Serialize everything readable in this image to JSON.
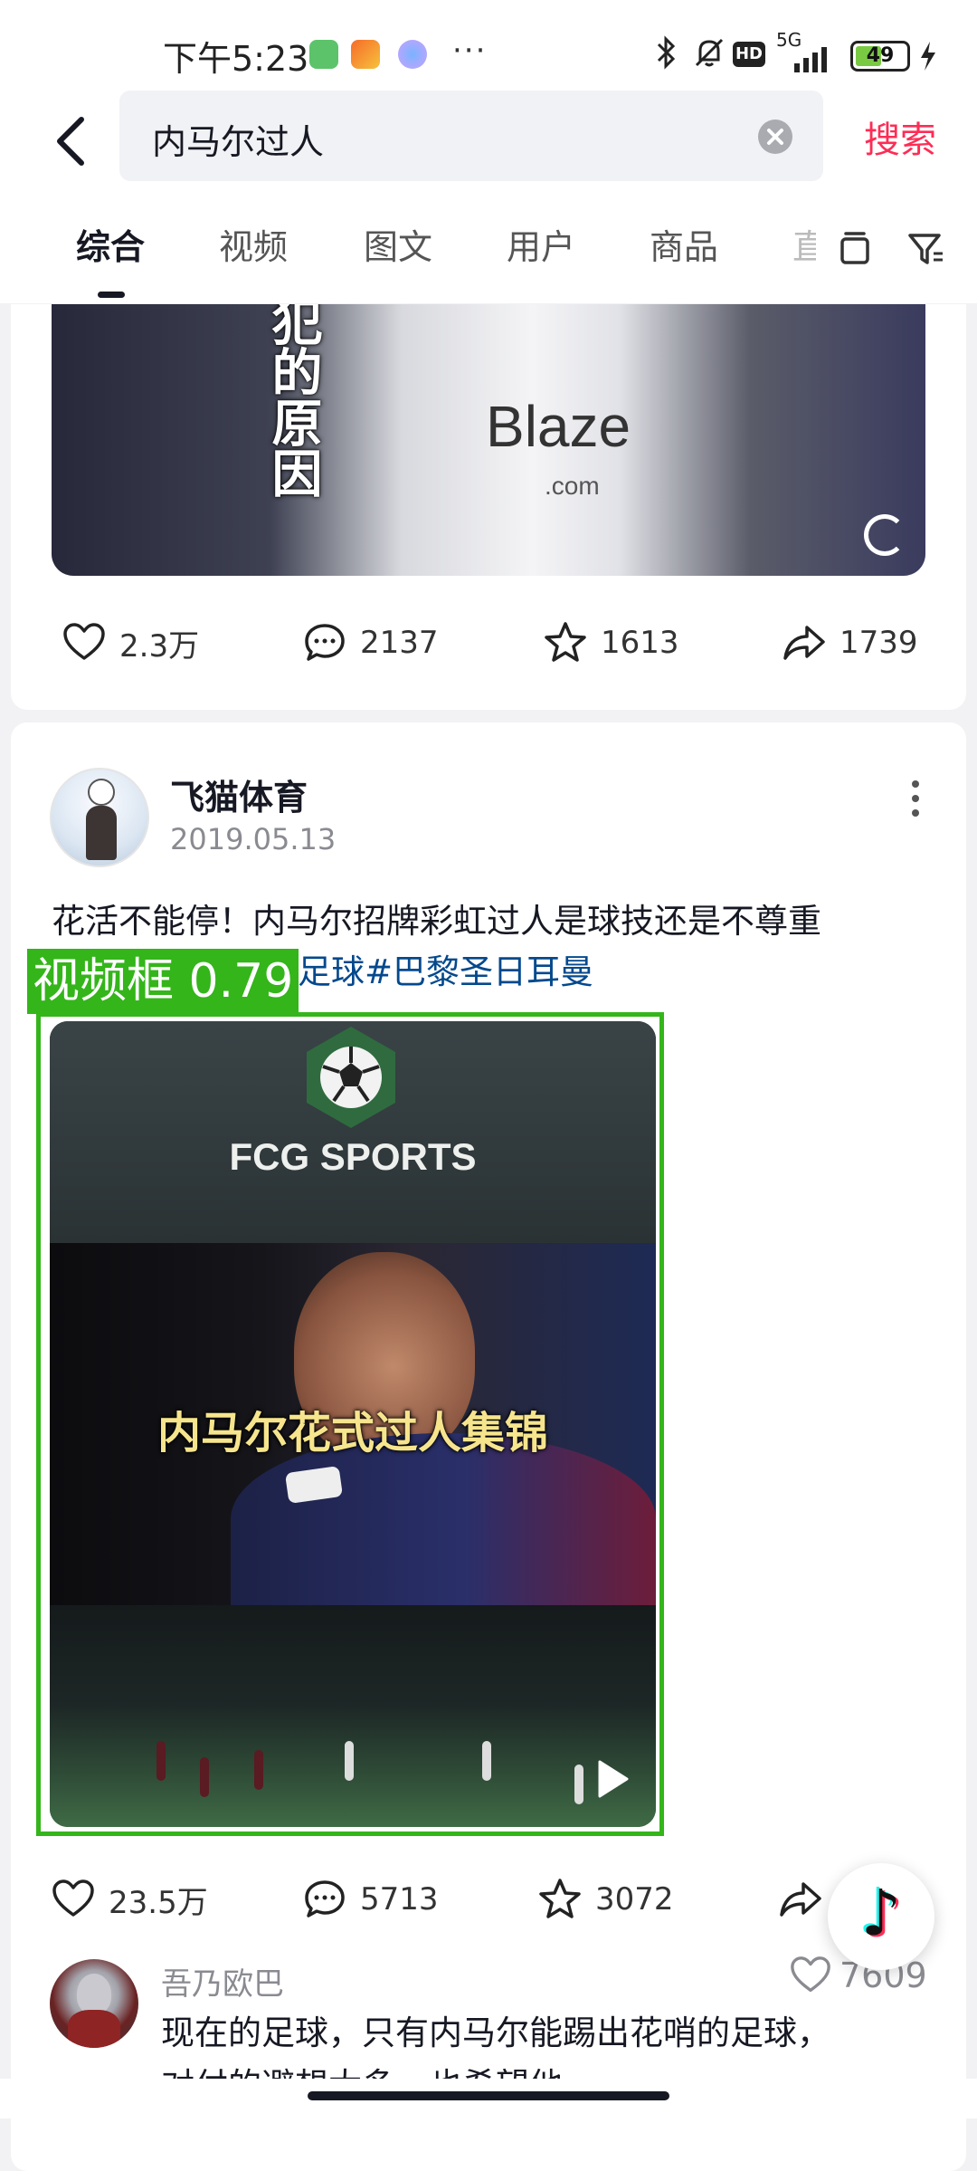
{
  "status_bar": {
    "time": "下午5:23",
    "dots": "···",
    "network": "5G",
    "hd": "HD",
    "battery": "49"
  },
  "search": {
    "query": "内马尔过人",
    "search_label": "搜索"
  },
  "tabs": [
    {
      "label": "综合",
      "active": true
    },
    {
      "label": "视频",
      "active": false
    },
    {
      "label": "图文",
      "active": false
    },
    {
      "label": "用户",
      "active": false
    },
    {
      "label": "商品",
      "active": false
    },
    {
      "label": "直",
      "active": false
    }
  ],
  "post_1": {
    "overlay_text": "犯的原因",
    "jersey_logo": "Blaze",
    "jersey_sub": ".com",
    "likes": "2.3万",
    "comments": "2137",
    "favorites": "1613",
    "shares": "1739"
  },
  "post_2": {
    "author": "飞猫体育",
    "date": "2019.05.13",
    "caption": "花活不能停！内马尔招牌彩虹过人是球技还是不尊重",
    "caption_tags": "足球#巴黎圣日耳曼",
    "thumb_brand": "FCG SPORTS",
    "thumb_title": "内马尔花式过人集锦",
    "likes": "23.5万",
    "comments": "5713",
    "favorites": "3072"
  },
  "detection": {
    "label": "视频框 0.79"
  },
  "comment": {
    "user": "吾乃欧巴",
    "likes": "7609",
    "text": "现在的足球，只有内马尔能踢出花哨的足球，",
    "text_cont": "对付的避想太多，也希望他"
  },
  "colors": {
    "accent": "#fe2c55",
    "tag_link": "#04498d",
    "detection": "#34b51a"
  }
}
